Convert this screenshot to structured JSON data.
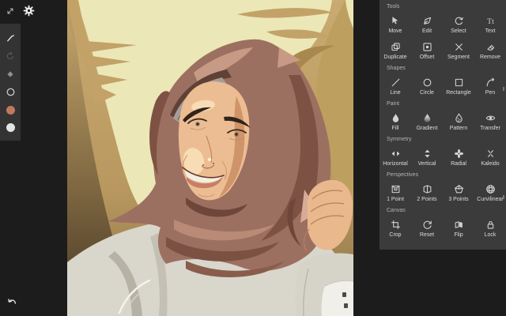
{
  "app": {
    "background": "#1c1c1c",
    "panel_background": "#3b3b3b"
  },
  "left_toolbar": {
    "top": [
      {
        "icon": "expand-icon"
      },
      {
        "icon": "settings-gear-icon"
      }
    ],
    "strip": [
      {
        "icon": "brush-icon"
      },
      {
        "icon": "redo-icon",
        "disabled": true
      },
      {
        "icon": "eraser-icon"
      },
      {
        "icon": "stroke-ring-icon"
      },
      {
        "icon": "color-swatch",
        "color": "#c1795d"
      },
      {
        "icon": "color-swatch",
        "color": "#e4e4e4"
      }
    ],
    "undo": {
      "icon": "undo-icon"
    }
  },
  "panel": {
    "sections": [
      {
        "label": "Tools",
        "items": [
          {
            "label": "Move",
            "icon": "move-icon"
          },
          {
            "label": "Edit",
            "icon": "edit-icon"
          },
          {
            "label": "Select",
            "icon": "select-icon"
          },
          {
            "label": "Text",
            "icon": "text-icon"
          },
          {
            "label": "Duplicate",
            "icon": "duplicate-icon"
          },
          {
            "label": "Offset",
            "icon": "offset-icon"
          },
          {
            "label": "Segment",
            "icon": "segment-icon"
          },
          {
            "label": "Remove",
            "icon": "remove-icon"
          }
        ]
      },
      {
        "label": "Shapes",
        "items": [
          {
            "label": "Line",
            "icon": "line-icon"
          },
          {
            "label": "Circle",
            "icon": "circle-icon"
          },
          {
            "label": "Rectangle",
            "icon": "rectangle-icon"
          },
          {
            "label": "Pen",
            "icon": "pen-icon"
          }
        ]
      },
      {
        "label": "Paint",
        "items": [
          {
            "label": "Fill",
            "icon": "fill-icon"
          },
          {
            "label": "Gradient",
            "icon": "gradient-icon"
          },
          {
            "label": "Pattern",
            "icon": "pattern-icon"
          },
          {
            "label": "Transfer",
            "icon": "transfer-icon"
          }
        ]
      },
      {
        "label": "Symmetry",
        "items": [
          {
            "label": "Horizontal",
            "icon": "symmetry-horizontal-icon"
          },
          {
            "label": "Vertical",
            "icon": "symmetry-vertical-icon"
          },
          {
            "label": "Radial",
            "icon": "symmetry-radial-icon"
          },
          {
            "label": "Kaleido",
            "icon": "kaleido-icon"
          }
        ]
      },
      {
        "label": "Perspectives",
        "items": [
          {
            "label": "1 Point",
            "icon": "perspective-1point-icon"
          },
          {
            "label": "2 Points",
            "icon": "perspective-2points-icon"
          },
          {
            "label": "3 Points",
            "icon": "perspective-3points-icon"
          },
          {
            "label": "Curvilinear",
            "icon": "curvilinear-icon"
          }
        ]
      },
      {
        "label": "Canvas",
        "items": [
          {
            "label": "Crop",
            "icon": "crop-icon"
          },
          {
            "label": "Reset",
            "icon": "reset-icon"
          },
          {
            "label": "Flip",
            "icon": "flip-icon"
          },
          {
            "label": "Lock",
            "icon": "lock-icon"
          }
        ]
      }
    ]
  },
  "canvas": {
    "artwork_alt": "Vector portrait of a smiling young woman in a brown hijab and light grey top, cream and tan feathered background",
    "palette": {
      "background_pale": "#ece7b6",
      "background_tan": "#c9aa70",
      "background_dark_brown": "#5a4930",
      "hijab": "#9c7061",
      "hijab_dark": "#7b5143",
      "hijab_light": "#c79a86",
      "skin": "#ecbd93",
      "skin_shadow": "#cf9469",
      "garment": "#d9d6cc"
    }
  }
}
